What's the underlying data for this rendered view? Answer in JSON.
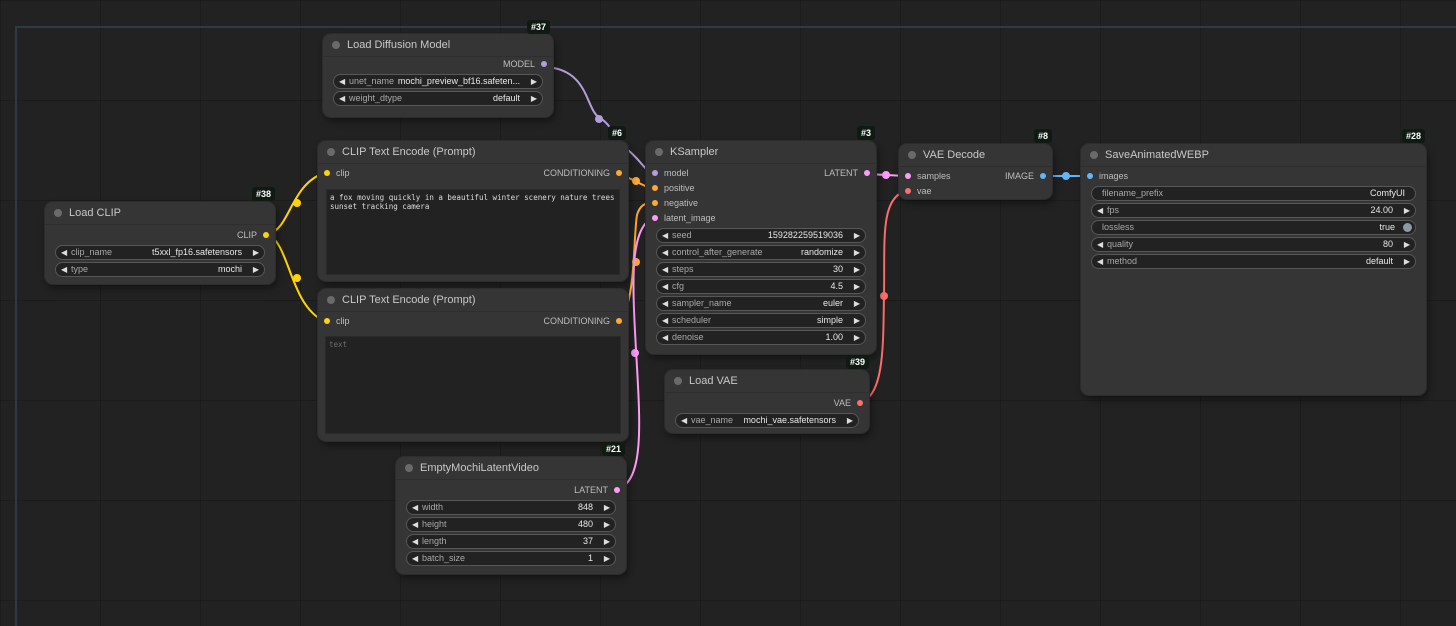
{
  "colors": {
    "model": "#b39ddb",
    "clip": "#ffd500",
    "conditioning": "#ffa931",
    "latent": "#ff9cf9",
    "vae": "#ff6e6e",
    "image": "#64b5f6"
  },
  "nodes": {
    "load_diffusion_model": {
      "id": "#37",
      "title": "Load Diffusion Model",
      "outputs": [
        "MODEL"
      ],
      "widgets": [
        {
          "label": "unet_name",
          "value": "mochi_preview_bf16.safeten..."
        },
        {
          "label": "weight_dtype",
          "value": "default"
        }
      ]
    },
    "load_clip": {
      "id": "#38",
      "title": "Load CLIP",
      "outputs": [
        "CLIP"
      ],
      "widgets": [
        {
          "label": "clip_name",
          "value": "t5xxl_fp16.safetensors"
        },
        {
          "label": "type",
          "value": "mochi"
        }
      ]
    },
    "clip_text_encode_positive": {
      "id": "#6",
      "title": "CLIP Text Encode (Prompt)",
      "inputs": [
        "clip"
      ],
      "outputs": [
        "CONDITIONING"
      ],
      "text": "a fox moving quickly in a beautiful winter scenery nature trees sunset tracking camera"
    },
    "clip_text_encode_negative": {
      "id": "#7",
      "title": "CLIP Text Encode (Prompt)",
      "inputs": [
        "clip"
      ],
      "outputs": [
        "CONDITIONING"
      ],
      "text": "",
      "placeholder": "text"
    },
    "ksampler": {
      "id": "#3",
      "title": "KSampler",
      "inputs": [
        "model",
        "positive",
        "negative",
        "latent_image"
      ],
      "outputs": [
        "LATENT"
      ],
      "widgets": [
        {
          "label": "seed",
          "value": "159282259519036"
        },
        {
          "label": "control_after_generate",
          "value": "randomize"
        },
        {
          "label": "steps",
          "value": "30"
        },
        {
          "label": "cfg",
          "value": "4.5"
        },
        {
          "label": "sampler_name",
          "value": "euler"
        },
        {
          "label": "scheduler",
          "value": "simple"
        },
        {
          "label": "denoise",
          "value": "1.00"
        }
      ]
    },
    "vae_decode": {
      "id": "#8",
      "title": "VAE Decode",
      "inputs": [
        "samples",
        "vae"
      ],
      "outputs": [
        "IMAGE"
      ]
    },
    "save_animated_webp": {
      "id": "#28",
      "title": "SaveAnimatedWEBP",
      "inputs": [
        "images"
      ],
      "widgets": [
        {
          "label": "filename_prefix",
          "value": "ComfyUI"
        },
        {
          "label": "fps",
          "value": "24.00"
        },
        {
          "label": "lossless",
          "value": "true"
        },
        {
          "label": "quality",
          "value": "80"
        },
        {
          "label": "method",
          "value": "default"
        }
      ]
    },
    "load_vae": {
      "id": "#39",
      "title": "Load VAE",
      "outputs": [
        "VAE"
      ],
      "widgets": [
        {
          "label": "vae_name",
          "value": "mochi_vae.safetensors"
        }
      ]
    },
    "empty_mochi_latent_video": {
      "id": "#21",
      "title": "EmptyMochiLatentVideo",
      "outputs": [
        "LATENT"
      ],
      "widgets": [
        {
          "label": "width",
          "value": "848"
        },
        {
          "label": "height",
          "value": "480"
        },
        {
          "label": "length",
          "value": "37"
        },
        {
          "label": "batch_size",
          "value": "1"
        }
      ]
    }
  },
  "icons": {
    "arrow_left": "◀",
    "arrow_right": "▶"
  }
}
